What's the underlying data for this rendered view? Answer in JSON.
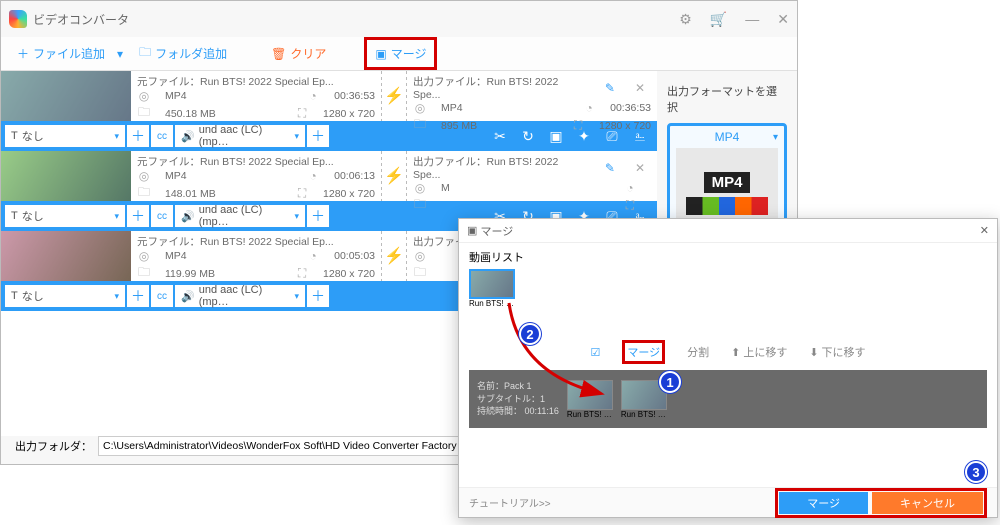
{
  "app": {
    "title": "ビデオコンバータ"
  },
  "toolbar": {
    "addFile": "ファイル追加",
    "addFolder": "フォルダ追加",
    "clear": "クリア",
    "merge": "マージ"
  },
  "columns": {
    "src": "元ファイル：",
    "out": "出力ファイル："
  },
  "items": [
    {
      "name": "Run BTS! 2022 Special Ep...",
      "outName": "Run BTS! 2022 Spe...",
      "format": "MP4",
      "outFormat": "MP4",
      "duration": "00:36:53",
      "outDuration": "00:36:53",
      "size": "450.18 MB",
      "outSize": "895 MB",
      "dim": "1280 x 720",
      "outDim": "1280 x 720",
      "audio": "und aac (LC) (mp…",
      "subtitle": "なし"
    },
    {
      "name": "Run BTS! 2022 Special Ep...",
      "outName": "Run BTS! 2022 Spe...",
      "format": "MP4",
      "outFormat": "M",
      "duration": "00:06:13",
      "outDuration": "",
      "size": "148.01 MB",
      "outSize": "",
      "dim": "1280 x 720",
      "outDim": "",
      "audio": "und aac (LC) (mp…",
      "subtitle": "なし"
    },
    {
      "name": "Run BTS! 2022 Special Ep...",
      "outName": "出力",
      "format": "MP4",
      "outFormat": "",
      "duration": "00:05:03",
      "outDuration": "",
      "size": "119.99 MB",
      "outSize": "",
      "dim": "1280 x 720",
      "outDim": "",
      "audio": "und aac (LC) (mp…",
      "subtitle": "なし"
    }
  ],
  "side": {
    "label": "出力フォーマットを選択",
    "format": "MP4",
    "badge": "MP4"
  },
  "output": {
    "label": "出力フォルダ：",
    "path": "C:\\Users\\Administrator\\Videos\\WonderFox Soft\\HD Video Converter Factory Pro\\OutputVideo\\"
  },
  "mergeDlg": {
    "title": "マージ",
    "listLabel": "動画リスト",
    "thumbCap": "Run BTS! 2...",
    "ops": {
      "merge": "マージ",
      "split": "分割",
      "up": "上に移す",
      "down": "下に移す"
    },
    "pack": {
      "name": "名前：Pack 1",
      "sub": "サブタイトル：1",
      "dur": "持続時間： 00:11:16"
    },
    "footer": {
      "tutorial": "チュートリアル>>",
      "merge": "マージ",
      "cancel": "キャンセル"
    }
  },
  "icons": {
    "plus": "＋",
    "folder": "🗀",
    "trash": "🗑",
    "mergeIc": "▣",
    "caret": "▾",
    "gear": "⚙",
    "cart": "🛒",
    "min": "—",
    "close": "✕",
    "clock": "◔",
    "dim": "⛶",
    "format": "◎",
    "size": "🗀",
    "bolt": "⚡",
    "pen": "✎",
    "scissors": "✂",
    "rotate": "↻",
    "crop": "▣",
    "fx": "✦",
    "water": "⎚",
    "sub": "⎁",
    "speaker": "🔊",
    "cc": "cc",
    "text": "T",
    "check": "☑",
    "arrUp": "⬆",
    "arrDown": "⬇"
  }
}
